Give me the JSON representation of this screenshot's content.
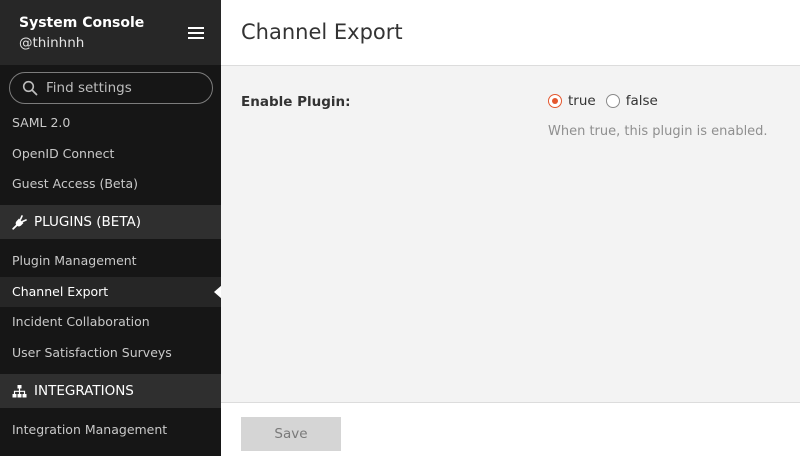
{
  "sidebar": {
    "title": "System Console",
    "username": "@thinhnh",
    "search_placeholder": "Find settings",
    "items_top": [
      "SAML 2.0",
      "OpenID Connect",
      "Guest Access (Beta)"
    ],
    "section_plugins": "PLUGINS (BETA)",
    "items_plugins": [
      "Plugin Management",
      "Channel Export",
      "Incident Collaboration",
      "User Satisfaction Surveys"
    ],
    "section_integrations": "INTEGRATIONS",
    "items_integrations": [
      "Integration Management"
    ],
    "active_item": "Channel Export"
  },
  "main": {
    "page_title": "Channel Export",
    "setting_label": "Enable Plugin:",
    "option_true": "true",
    "option_false": "false",
    "selected_option": "true",
    "help_text": "When true, this plugin is enabled.",
    "save_label": "Save"
  },
  "colors": {
    "accent": "#e4572e",
    "sidebar_bg": "#161616"
  }
}
